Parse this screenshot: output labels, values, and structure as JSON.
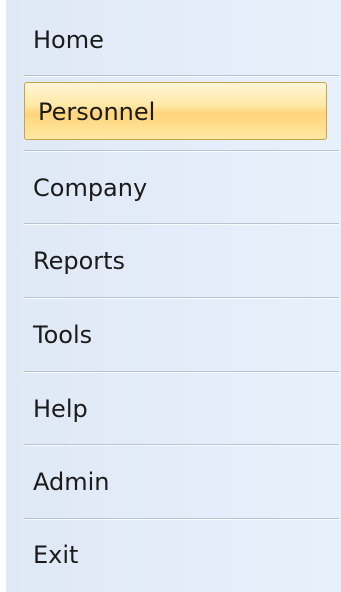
{
  "menu": {
    "items": [
      {
        "label": "Home"
      },
      {
        "label": "Personnel",
        "selected": true
      },
      {
        "label": "Company"
      },
      {
        "label": "Reports"
      },
      {
        "label": "Tools"
      },
      {
        "label": "Help"
      },
      {
        "label": "Admin"
      },
      {
        "label": "Exit"
      }
    ],
    "selected_index": 1
  }
}
